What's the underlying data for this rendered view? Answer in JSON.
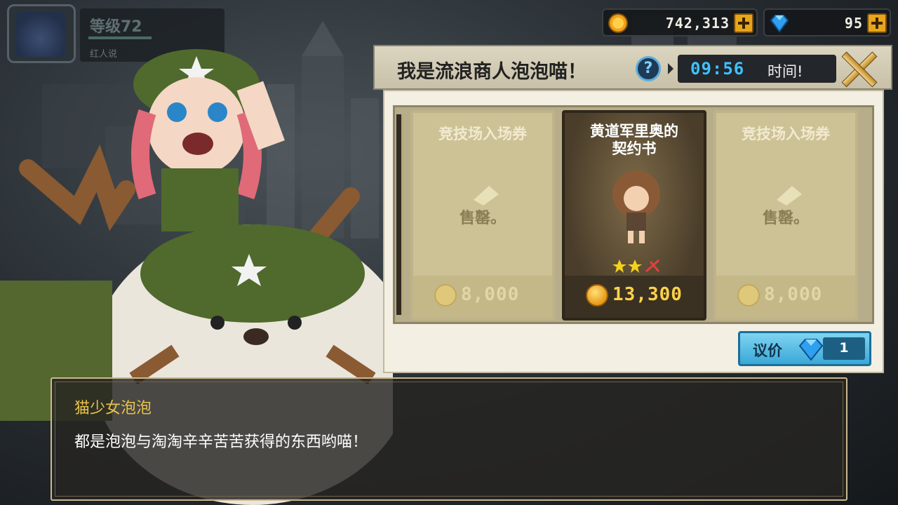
{
  "player": {
    "level": "等级72",
    "subtitle": "红人说"
  },
  "currency": {
    "gold": "742,313",
    "gems": "95",
    "gold_icon": "gold-coin-icon",
    "gem_icon": "blue-gem-icon"
  },
  "shop": {
    "title": "我是流浪商人泡泡喵！",
    "help_symbol": "?",
    "timer": "09:56",
    "timer_label": "时间!",
    "items": [
      {
        "name": "竞技场入场券",
        "status": "售罄。",
        "price": "8,000",
        "sold_out": true
      },
      {
        "name_line1": "黄道军里奥的",
        "name_line2": "契约书",
        "price": "13,300",
        "stars": 2,
        "sold_out": false
      },
      {
        "name": "竞技场入场券",
        "status": "售罄。",
        "price": "8,000",
        "sold_out": true
      }
    ],
    "bargain": {
      "label": "议价",
      "count": "1"
    }
  },
  "dialog": {
    "speaker": "猫少女泡泡",
    "text": "都是泡泡与淘淘辛辛苦苦获得的东西哟喵！"
  },
  "colors": {
    "gold": "#e69a16",
    "gem_blue": "#3ec2ff",
    "speaker": "#e8c24c"
  }
}
